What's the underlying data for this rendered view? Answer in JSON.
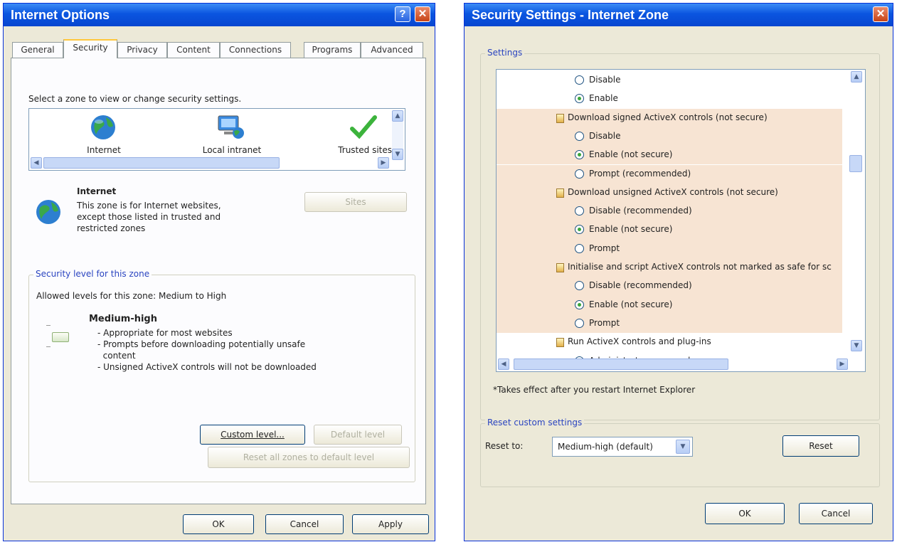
{
  "left": {
    "title": "Internet Options",
    "help_glyph": "?",
    "close_glyph": "✕",
    "tabs": [
      "General",
      "Security",
      "Privacy",
      "Content",
      "Connections",
      "Programs",
      "Advanced"
    ],
    "zone_prompt": "Select a zone to view or change security settings.",
    "zones": [
      {
        "label": "Internet",
        "icon": "globe-icon"
      },
      {
        "label": "Local intranet",
        "icon": "intranet-icon"
      },
      {
        "label": "Trusted sites",
        "icon": "checkmark-icon"
      }
    ],
    "zone_title": "Internet",
    "zone_desc": [
      "This zone is for Internet websites,",
      "except those listed in trusted and",
      "restricted zones"
    ],
    "sites_button": "Sites",
    "security_group_label": "Security level for this zone",
    "allowed_levels": "Allowed levels for this zone: Medium to High",
    "level_name": "Medium-high",
    "level_points": [
      "- Appropriate for most websites",
      "- Prompts before downloading potentially unsafe",
      "  content",
      "- Unsigned ActiveX controls will not be downloaded"
    ],
    "custom_level_button": "Custom level...",
    "default_level_button": "Default level",
    "reset_all_button": "Reset all zones to default level",
    "ok_button": "OK",
    "cancel_button": "Cancel",
    "apply_button": "Apply"
  },
  "right": {
    "title": "Security Settings - Internet Zone",
    "close_glyph": "✕",
    "settings_label": "Settings",
    "rows": [
      {
        "kind": "radio",
        "text": "Disable",
        "checked": false
      },
      {
        "kind": "radio",
        "text": "Enable",
        "checked": true
      },
      {
        "kind": "header",
        "text": "Download signed ActiveX controls (not secure)"
      },
      {
        "kind": "radio",
        "text": "Disable",
        "checked": false
      },
      {
        "kind": "radio",
        "text": "Enable (not secure)",
        "checked": true
      },
      {
        "kind": "radio",
        "text": "Prompt (recommended)",
        "checked": false
      },
      {
        "kind": "header",
        "text": "Download unsigned ActiveX controls (not secure)"
      },
      {
        "kind": "radio",
        "text": "Disable (recommended)",
        "checked": false
      },
      {
        "kind": "radio",
        "text": "Enable (not secure)",
        "checked": true
      },
      {
        "kind": "radio",
        "text": "Prompt",
        "checked": false
      },
      {
        "kind": "header",
        "text": "Initialise and script ActiveX controls not marked as safe for sc"
      },
      {
        "kind": "radio",
        "text": "Disable (recommended)",
        "checked": false
      },
      {
        "kind": "radio",
        "text": "Enable (not secure)",
        "checked": true
      },
      {
        "kind": "radio",
        "text": "Prompt",
        "checked": false
      },
      {
        "kind": "header",
        "text": "Run ActiveX controls and plug-ins"
      },
      {
        "kind": "radio",
        "text": "Administrator approved",
        "checked": false
      }
    ],
    "footnote": "*Takes effect after you restart Internet Explorer",
    "reset_group_label": "Reset custom settings",
    "reset_to_label": "Reset to:",
    "reset_select_value": "Medium-high (default)",
    "reset_button": "Reset",
    "ok_button": "OK",
    "cancel_button": "Cancel"
  }
}
